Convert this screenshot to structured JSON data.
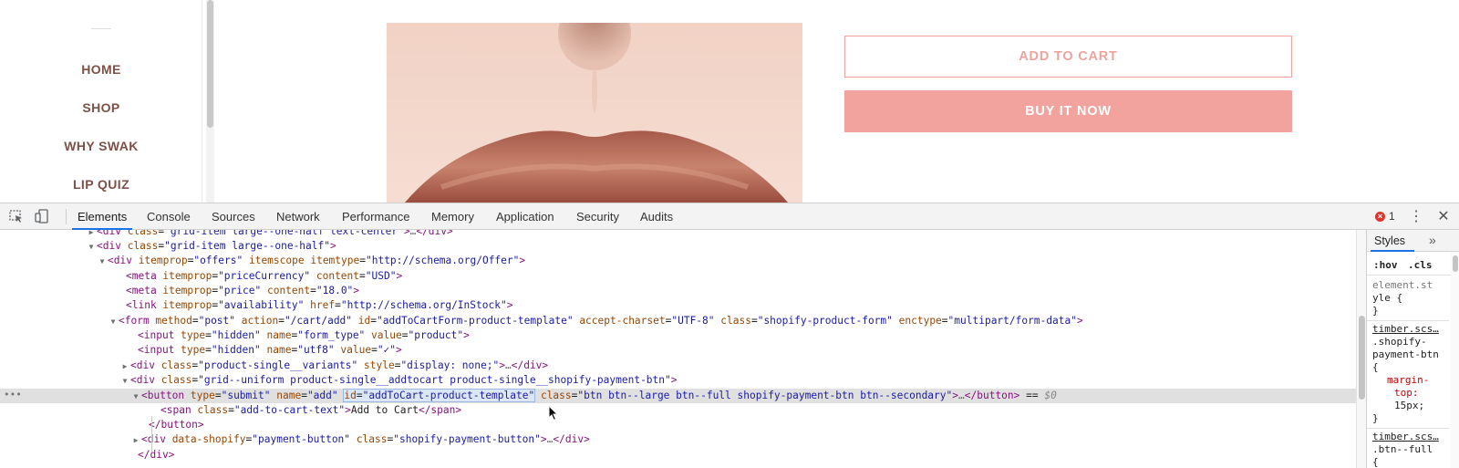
{
  "site": {
    "nav_items": [
      "HOME",
      "SHOP",
      "WHY SWAK",
      "LIP QUIZ"
    ],
    "add_to_cart_label": "ADD TO CART",
    "buy_now_label": "BUY IT NOW",
    "accent_color": "#f2a39d",
    "nav_color": "#7d5148"
  },
  "devtools": {
    "tabs": [
      "Elements",
      "Console",
      "Sources",
      "Network",
      "Performance",
      "Memory",
      "Application",
      "Security",
      "Audits"
    ],
    "active_tab": "Elements",
    "error_count": "1",
    "styles_pane": {
      "tab_label": "Styles",
      "more_glyph": "»",
      "filter_hov": ":hov",
      "filter_cls": ".cls",
      "element_style_selector_1": "element.st",
      "element_style_selector_2": "yle {",
      "close_brace": "}",
      "source_1": "timber.scs…",
      "rule_1_selector_1": ".shopify-",
      "rule_1_selector_2": "payment-btn",
      "rule_1_open": "{",
      "rule_1_prop_1": "margin-",
      "rule_1_prop_2": "top:",
      "rule_1_value": "15px;",
      "source_2": "timber.scs…",
      "rule_2_selector": ".btn--full",
      "rule_2_open": "{"
    },
    "row_menu_glyph": "•••",
    "tree_lines": [
      [
        [
          "tag",
          "<div "
        ],
        [
          "an",
          "class"
        ],
        [
          "eq",
          "="
        ],
        [
          "av",
          "\"grid-item large--one-half text-center\""
        ],
        [
          "tag",
          ">"
        ],
        [
          "ell",
          "…"
        ],
        [
          "tag",
          "</div>"
        ]
      ],
      [
        [
          "tag",
          "<div "
        ],
        [
          "an",
          "class"
        ],
        [
          "eq",
          "="
        ],
        [
          "av",
          "\"grid-item large--one-half\""
        ],
        [
          "tag",
          ">"
        ]
      ],
      [
        [
          "tag",
          "<div "
        ],
        [
          "an",
          "itemprop"
        ],
        [
          "eq",
          "="
        ],
        [
          "av",
          "\"offers\""
        ],
        [
          "tag",
          " "
        ],
        [
          "an",
          "itemscope"
        ],
        [
          "tag",
          " "
        ],
        [
          "an",
          "itemtype"
        ],
        [
          "eq",
          "="
        ],
        [
          "av",
          "\"http://schema.org/Offer\""
        ],
        [
          "tag",
          ">"
        ]
      ],
      [
        [
          "tag",
          "<meta "
        ],
        [
          "an",
          "itemprop"
        ],
        [
          "eq",
          "="
        ],
        [
          "av",
          "\"priceCurrency\""
        ],
        [
          "tag",
          " "
        ],
        [
          "an",
          "content"
        ],
        [
          "eq",
          "="
        ],
        [
          "av",
          "\"USD\""
        ],
        [
          "tag",
          ">"
        ]
      ],
      [
        [
          "tag",
          "<meta "
        ],
        [
          "an",
          "itemprop"
        ],
        [
          "eq",
          "="
        ],
        [
          "av",
          "\"price\""
        ],
        [
          "tag",
          " "
        ],
        [
          "an",
          "content"
        ],
        [
          "eq",
          "="
        ],
        [
          "av",
          "\"18.0\""
        ],
        [
          "tag",
          ">"
        ]
      ],
      [
        [
          "tag",
          "<link "
        ],
        [
          "an",
          "itemprop"
        ],
        [
          "eq",
          "="
        ],
        [
          "av",
          "\"availability\""
        ],
        [
          "tag",
          " "
        ],
        [
          "an",
          "href"
        ],
        [
          "eq",
          "="
        ],
        [
          "av",
          "\""
        ],
        [
          "lnk",
          "http://schema.org/InStock"
        ],
        [
          "av",
          "\""
        ],
        [
          "tag",
          ">"
        ]
      ],
      [
        [
          "tag",
          "<form "
        ],
        [
          "an",
          "method"
        ],
        [
          "eq",
          "="
        ],
        [
          "av",
          "\"post\""
        ],
        [
          "tag",
          " "
        ],
        [
          "an",
          "action"
        ],
        [
          "eq",
          "="
        ],
        [
          "av",
          "\"/cart/add\""
        ],
        [
          "tag",
          " "
        ],
        [
          "an",
          "id"
        ],
        [
          "eq",
          "="
        ],
        [
          "av",
          "\"addToCartForm-product-template\""
        ],
        [
          "tag",
          " "
        ],
        [
          "an",
          "accept-charset"
        ],
        [
          "eq",
          "="
        ],
        [
          "av",
          "\"UTF-8\""
        ],
        [
          "tag",
          " "
        ],
        [
          "an",
          "class"
        ],
        [
          "eq",
          "="
        ],
        [
          "av",
          "\"shopify-product-form\""
        ],
        [
          "tag",
          " "
        ],
        [
          "an",
          "enctype"
        ],
        [
          "eq",
          "="
        ],
        [
          "av",
          "\"multipart/form-data\""
        ],
        [
          "tag",
          ">"
        ]
      ],
      [
        [
          "tag",
          "<input "
        ],
        [
          "an",
          "type"
        ],
        [
          "eq",
          "="
        ],
        [
          "av",
          "\"hidden\""
        ],
        [
          "tag",
          " "
        ],
        [
          "an",
          "name"
        ],
        [
          "eq",
          "="
        ],
        [
          "av",
          "\"form_type\""
        ],
        [
          "tag",
          " "
        ],
        [
          "an",
          "value"
        ],
        [
          "eq",
          "="
        ],
        [
          "av",
          "\"product\""
        ],
        [
          "tag",
          ">"
        ]
      ],
      [
        [
          "tag",
          "<input "
        ],
        [
          "an",
          "type"
        ],
        [
          "eq",
          "="
        ],
        [
          "av",
          "\"hidden\""
        ],
        [
          "tag",
          " "
        ],
        [
          "an",
          "name"
        ],
        [
          "eq",
          "="
        ],
        [
          "av",
          "\"utf8\""
        ],
        [
          "tag",
          " "
        ],
        [
          "an",
          "value"
        ],
        [
          "eq",
          "="
        ],
        [
          "av",
          "\"✓\""
        ],
        [
          "tag",
          ">"
        ]
      ],
      [
        [
          "tag",
          "<div "
        ],
        [
          "an",
          "class"
        ],
        [
          "eq",
          "="
        ],
        [
          "av",
          "\"product-single__variants\""
        ],
        [
          "tag",
          " "
        ],
        [
          "an",
          "style"
        ],
        [
          "eq",
          "="
        ],
        [
          "av",
          "\"display: none;\""
        ],
        [
          "tag",
          ">"
        ],
        [
          "ell",
          "…"
        ],
        [
          "tag",
          "</div>"
        ]
      ],
      [
        [
          "tag",
          "<div "
        ],
        [
          "an",
          "class"
        ],
        [
          "eq",
          "="
        ],
        [
          "av",
          "\"grid--uniform product-single__addtocart product-single__shopify-payment-btn\""
        ],
        [
          "tag",
          ">"
        ]
      ],
      [
        [
          "tag",
          "<button "
        ],
        [
          "an",
          "type"
        ],
        [
          "eq",
          "="
        ],
        [
          "av",
          "\"submit\""
        ],
        [
          "tag",
          " "
        ],
        [
          "an",
          "name"
        ],
        [
          "eq",
          "="
        ],
        [
          "av",
          "\"add\""
        ],
        [
          "tag",
          " "
        ],
        [
          "hl_an",
          "id"
        ],
        [
          "hl_eq",
          "="
        ],
        [
          "hl_av",
          "\"addToCart-product-template\""
        ],
        [
          "tag",
          " "
        ],
        [
          "an",
          "class"
        ],
        [
          "eq",
          "="
        ],
        [
          "av",
          "\"btn btn--large btn--full shopify-payment-btn btn--secondary\""
        ],
        [
          "tag",
          ">"
        ],
        [
          "ell",
          "…"
        ],
        [
          "tag",
          "</button>"
        ],
        [
          "eq",
          " == "
        ],
        [
          "dollar",
          "$0"
        ]
      ],
      [
        [
          "tag",
          "<span "
        ],
        [
          "an",
          "class"
        ],
        [
          "eq",
          "="
        ],
        [
          "av",
          "\"add-to-cart-text\""
        ],
        [
          "tag",
          ">"
        ],
        [
          "tx",
          "Add to Cart"
        ],
        [
          "tag",
          "</span>"
        ]
      ],
      [
        [
          "tag",
          "</button>"
        ]
      ],
      [
        [
          "tag",
          "<div "
        ],
        [
          "an",
          "data-shopify"
        ],
        [
          "eq",
          "="
        ],
        [
          "av",
          "\"payment-button\""
        ],
        [
          "tag",
          " "
        ],
        [
          "an",
          "class"
        ],
        [
          "eq",
          "="
        ],
        [
          "av",
          "\"shopify-payment-button\""
        ],
        [
          "tag",
          ">"
        ],
        [
          "ell",
          "…"
        ],
        [
          "tag",
          "</div>"
        ]
      ],
      [
        [
          "tag",
          "</div>"
        ]
      ]
    ]
  }
}
